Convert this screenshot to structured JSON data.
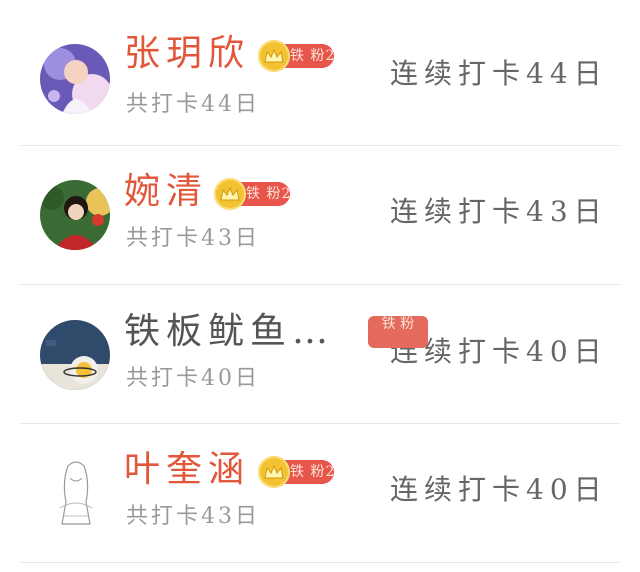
{
  "rows": [
    {
      "name": "张玥欣",
      "badge_level": "铁 粉2",
      "subtitle": "共打卡44日",
      "streak": "连续打卡44日",
      "is_vip": true
    },
    {
      "name": "婉清",
      "badge_level": "铁 粉2",
      "subtitle": "共打卡43日",
      "streak": "连续打卡43日",
      "is_vip": true
    },
    {
      "name": "铁板鱿鱼…",
      "badge_level": "铁 粉",
      "subtitle": "共打卡40日",
      "streak": "连续打卡40日",
      "is_vip": false
    },
    {
      "name": "叶奎涵",
      "badge_level": "铁 粉2",
      "subtitle": "共打卡43日",
      "streak": "连续打卡40日",
      "is_vip": true
    }
  ],
  "colors": {
    "vip_name": "#e2563a",
    "plain_name": "#555555",
    "badge_red": "#e8554a",
    "crown_gold": "#f2c230"
  }
}
